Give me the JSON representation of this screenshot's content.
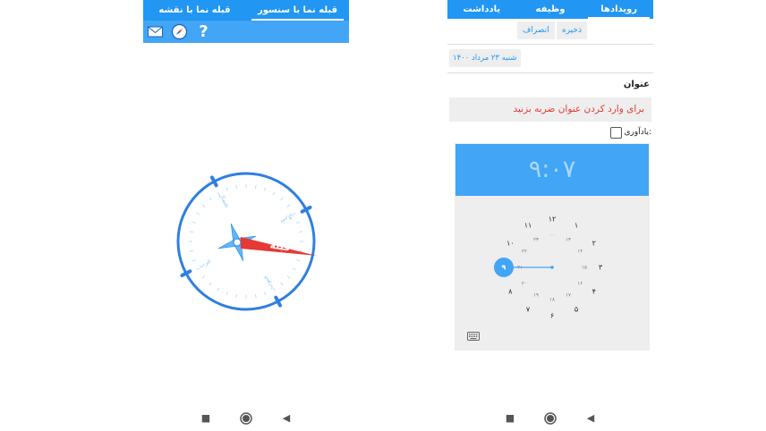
{
  "left_screen": {
    "tabs": [
      {
        "label": "قبله نما با سنسور",
        "active": true
      },
      {
        "label": "قبله نما با نقشه",
        "active": false
      }
    ],
    "toolbar": {
      "icons": [
        "mail-icon",
        "compass-icon",
        "help-icon"
      ],
      "help_glyph": "?"
    },
    "compass": {
      "needle_label": "قبله",
      "ring_color": "#2f7fe0",
      "needle_color": "#e53935",
      "rose_color": "#64b5f6",
      "heading_labels": [
        "شمال",
        "شرق",
        "جنوب",
        "غرب"
      ]
    }
  },
  "right_screen": {
    "tabs": [
      {
        "label": "رویدادها",
        "active": true
      },
      {
        "label": "وظیفه",
        "active": false
      },
      {
        "label": "یادداشت",
        "active": false
      }
    ],
    "actions": {
      "save_label": "ذخیره",
      "cancel_label": "انصراف"
    },
    "date_label": "شنبه ۲۳ مرداد ۱۴۰۰",
    "title_label": "عنوان",
    "title_placeholder": "برای وارد کردن عنوان ضربه بزنید",
    "reminder_label": "یادآوری:",
    "reminder_checked": false,
    "time_picker": {
      "display": "۹:۰۷",
      "outer_hours": [
        "۱۲",
        "۱",
        "۲",
        "۳",
        "۴",
        "۵",
        "۶",
        "۷",
        "۸",
        "۹",
        "۱۰",
        "۱۱"
      ],
      "inner_hours": [
        "۰۰",
        "۱۳",
        "۱۴",
        "۱۵",
        "۱۶",
        "۱۷",
        "۱۸",
        "۱۹",
        "۲۰",
        "۲۱",
        "۲۲",
        "۲۳"
      ],
      "selected_hour": "۹",
      "accent": "#42a5f5"
    }
  },
  "navigation_bar": {
    "icons": [
      "recent-apps-icon",
      "home-icon",
      "back-icon"
    ]
  }
}
